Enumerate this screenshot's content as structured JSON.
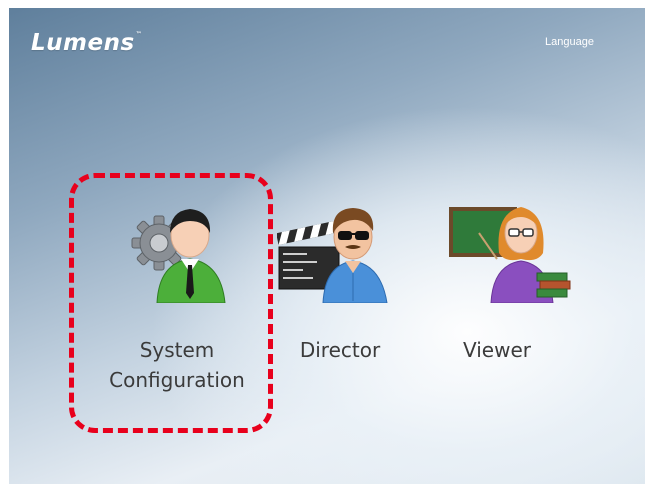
{
  "header": {
    "logo_text": "Lumens",
    "logo_trademark": "™",
    "language_link": "Language"
  },
  "menu": {
    "items": [
      {
        "label_line1": "System",
        "label_line2": "Configuration",
        "icon": "system-configuration-icon"
      },
      {
        "label_line1": "Director",
        "icon": "director-icon"
      },
      {
        "label_line1": "Viewer",
        "icon": "viewer-icon"
      }
    ]
  },
  "colors": {
    "highlight": "#e8001c",
    "label_text": "#3b3b3b",
    "header_text": "#ffffff"
  }
}
